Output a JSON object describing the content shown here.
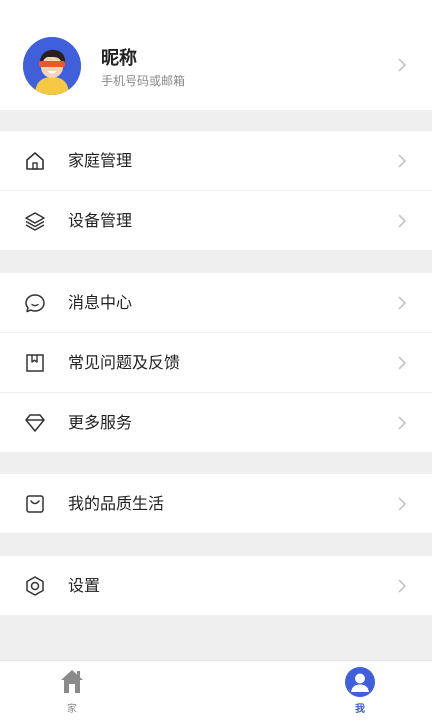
{
  "profile": {
    "nickname": "昵称",
    "subtitle": "手机号码或邮箱"
  },
  "menu": {
    "home_management": "家庭管理",
    "device_management": "设备管理",
    "messages": "消息中心",
    "faq_feedback": "常见问题及反馈",
    "more_services": "更多服务",
    "quality_life": "我的品质生活",
    "settings": "设置"
  },
  "tabbar": {
    "home_label": "家",
    "me_label": "我"
  },
  "colors": {
    "accent": "#3f5fdb",
    "inactive_tab": "#8a8a8a",
    "background": "#efefef"
  },
  "icons": {
    "home_management": "house-icon",
    "device_management": "layers-icon",
    "messages": "chat-bubble-icon",
    "faq_feedback": "bookmark-icon",
    "more_services": "diamond-icon",
    "quality_life": "shopping-bag-icon",
    "settings": "hexagon-gear-icon"
  }
}
